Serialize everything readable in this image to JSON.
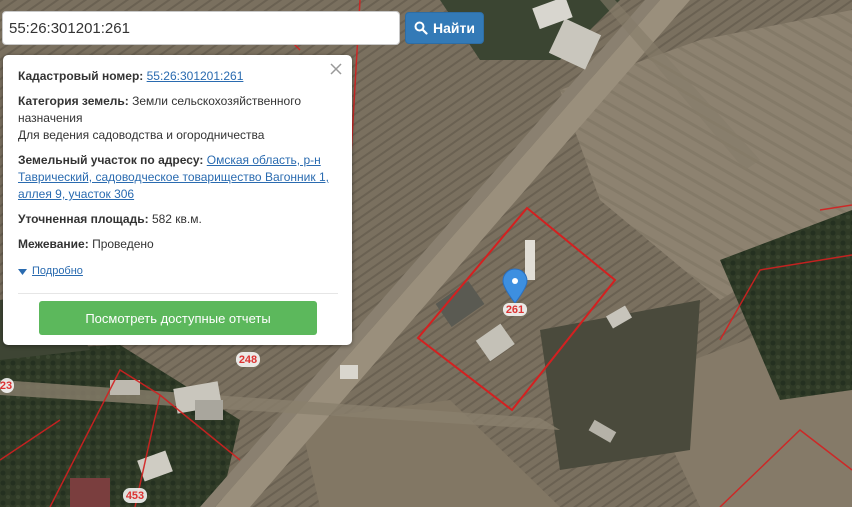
{
  "search": {
    "value": "55:26:301201:261",
    "button_label": "Найти"
  },
  "popup": {
    "cadastral_label": "Кадастровый номер:",
    "cadastral_number": "55:26:301201:261",
    "category_label": "Категория земель:",
    "category_value": "Земли сельскохозяйственного назначения",
    "category_use": "Для ведения садоводства и огородничества",
    "address_label": "Земельный участок по адресу:",
    "address_value": "Омская область, р-н Таврический, садоводческое товарищество Вагонник 1, аллея 9, участок 306",
    "area_label": "Уточненная площадь:",
    "area_value": "582 кв.м.",
    "survey_label": "Межевание:",
    "survey_value": "Проведено",
    "more_label": "Подробно",
    "report_button": "Посмотреть доступные отчеты"
  },
  "map": {
    "marker_label": "261",
    "plot_labels": [
      "248",
      "23",
      "453"
    ],
    "boundary_color": "#d42020",
    "marker_color": "#3d8fe0"
  }
}
